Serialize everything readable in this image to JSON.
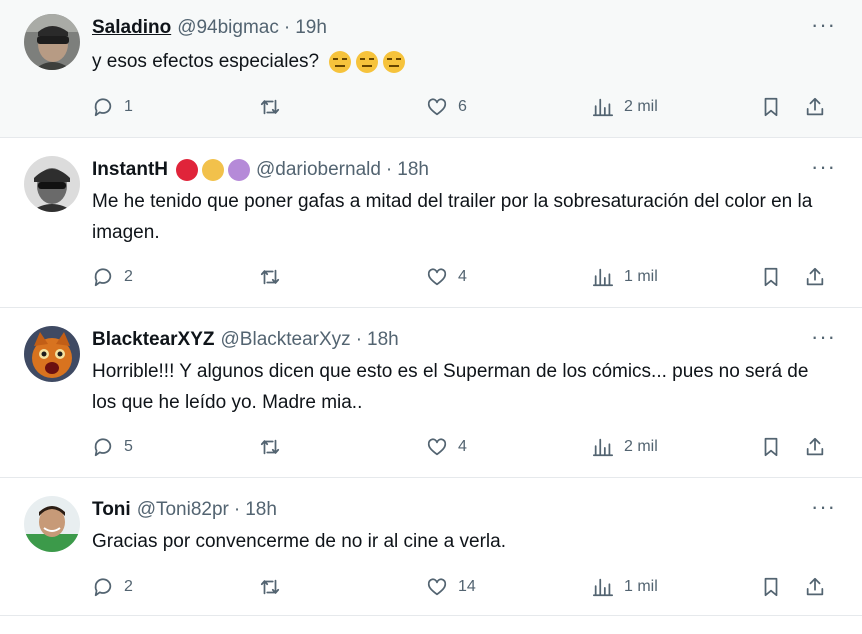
{
  "tweets": [
    {
      "name": "Saladino",
      "handle": "@94bigmac",
      "separator": "·",
      "time": "19h",
      "text": "y esos efectos especiales?",
      "reply_count": "1",
      "like_count": "6",
      "view_count": "2 mil"
    },
    {
      "name": "InstantH",
      "handle": "@dariobernald",
      "separator": "·",
      "time": "18h",
      "text": "Me he tenido que poner gafas a mitad del trailer por la sobresaturación del color en la imagen.",
      "reply_count": "2",
      "like_count": "4",
      "view_count": "1 mil",
      "badge_colors": [
        "#e0243a",
        "#f2c14b",
        "#b58ad8"
      ]
    },
    {
      "name": "BlacktearXYZ",
      "handle": "@BlacktearXyz",
      "separator": "·",
      "time": "18h",
      "text": "Horrible!!! Y algunos dicen que esto es el Superman de los cómics... pues no será de los que he leído yo. Madre mia..",
      "reply_count": "5",
      "like_count": "4",
      "view_count": "2 mil"
    },
    {
      "name": "Toni",
      "handle": "@Toni82pr",
      "separator": "·",
      "time": "18h",
      "text": "Gracias por convencerme de no ir al cine a verla.",
      "reply_count": "2",
      "like_count": "14",
      "view_count": "1 mil"
    }
  ],
  "icons": {
    "reply": "reply-icon",
    "retweet": "retweet-icon",
    "like": "heart-icon",
    "views": "views-icon",
    "bookmark": "bookmark-icon",
    "share": "share-icon",
    "more": "more-icon",
    "emoji": "expressionless-face-emoji"
  },
  "more_glyph": "···",
  "colors": {
    "text": "#0f1419",
    "muted": "#536471",
    "highlight_bg": "#f7f9f9",
    "border": "#e6e9ec"
  }
}
